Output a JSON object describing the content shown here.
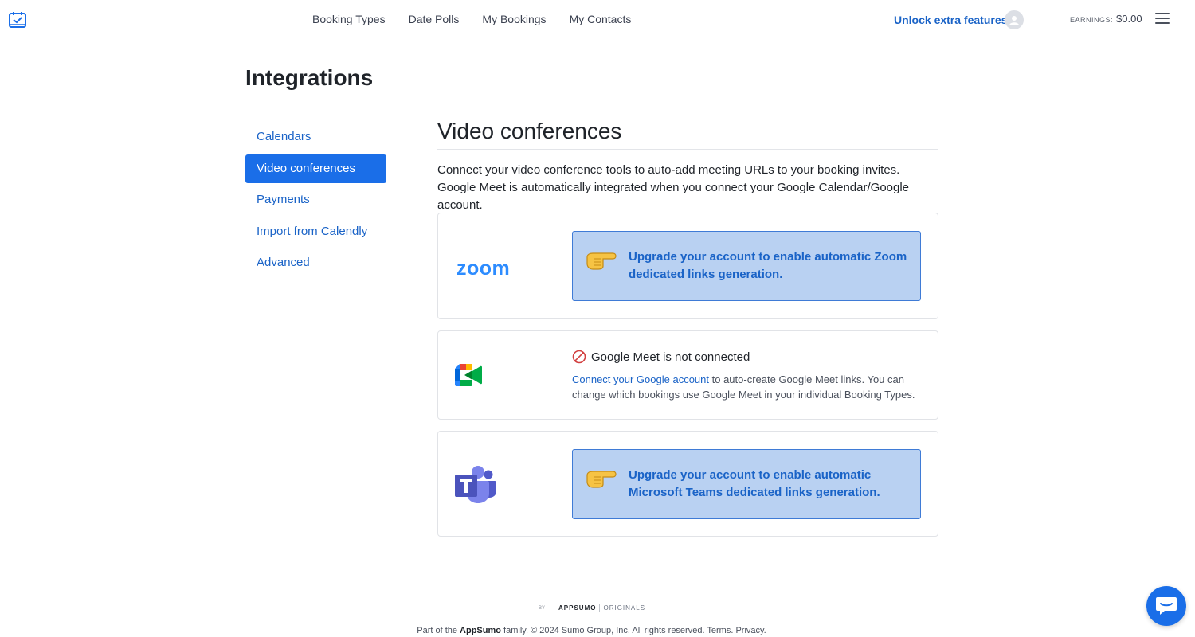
{
  "header": {
    "nav": [
      {
        "label": "Booking Types"
      },
      {
        "label": "Date Polls"
      },
      {
        "label": "My Bookings"
      },
      {
        "label": "My Contacts"
      }
    ],
    "unlock_label": "Unlock extra features!",
    "earnings_label": "EARNINGS:",
    "earnings_value": "$0.00"
  },
  "page": {
    "title": "Integrations"
  },
  "sidebar": {
    "items": [
      {
        "label": "Calendars",
        "active": false
      },
      {
        "label": "Video conferences",
        "active": true
      },
      {
        "label": "Payments",
        "active": false
      },
      {
        "label": "Import from Calendly",
        "active": false
      },
      {
        "label": "Advanced",
        "active": false
      }
    ]
  },
  "section": {
    "title": "Video conferences",
    "description": "Connect your video conference tools to auto-add meeting URLs to your booking invites. Google Meet is automatically integrated when you connect your Google Calendar/Google account."
  },
  "zoom": {
    "logo_text": "zoom",
    "upgrade_message": "Upgrade your account to enable automatic Zoom dedicated links generation."
  },
  "meet": {
    "status": "Google Meet is not connected",
    "connect_link": "Connect your Google account",
    "description_rest": " to auto-create Google Meet links. You can change which bookings use Google Meet in your individual Booking Types."
  },
  "teams": {
    "upgrade_message": "Upgrade your account to enable automatic Microsoft Teams dedicated links generation."
  },
  "footer": {
    "by": "BY",
    "brand": "APPSUMO",
    "originals": "ORIGINALS",
    "part_of": "Part of the ",
    "appsumo": "AppSumo",
    "rest": " family. © 2024 Sumo Group, Inc. All rights reserved. ",
    "terms": "Terms.",
    "privacy": "Privacy."
  },
  "colors": {
    "accent": "#1a6ee8",
    "link": "#1a63c7",
    "upgrade_bg": "#b9d1f2",
    "zoom_blue": "#2d8cff"
  },
  "icons": {
    "logo": "calendar-check-icon",
    "menu": "hamburger-icon",
    "hand": "pointing-hand-icon",
    "not_connected": "prohibited-icon",
    "chat": "chat-bubble-icon"
  }
}
